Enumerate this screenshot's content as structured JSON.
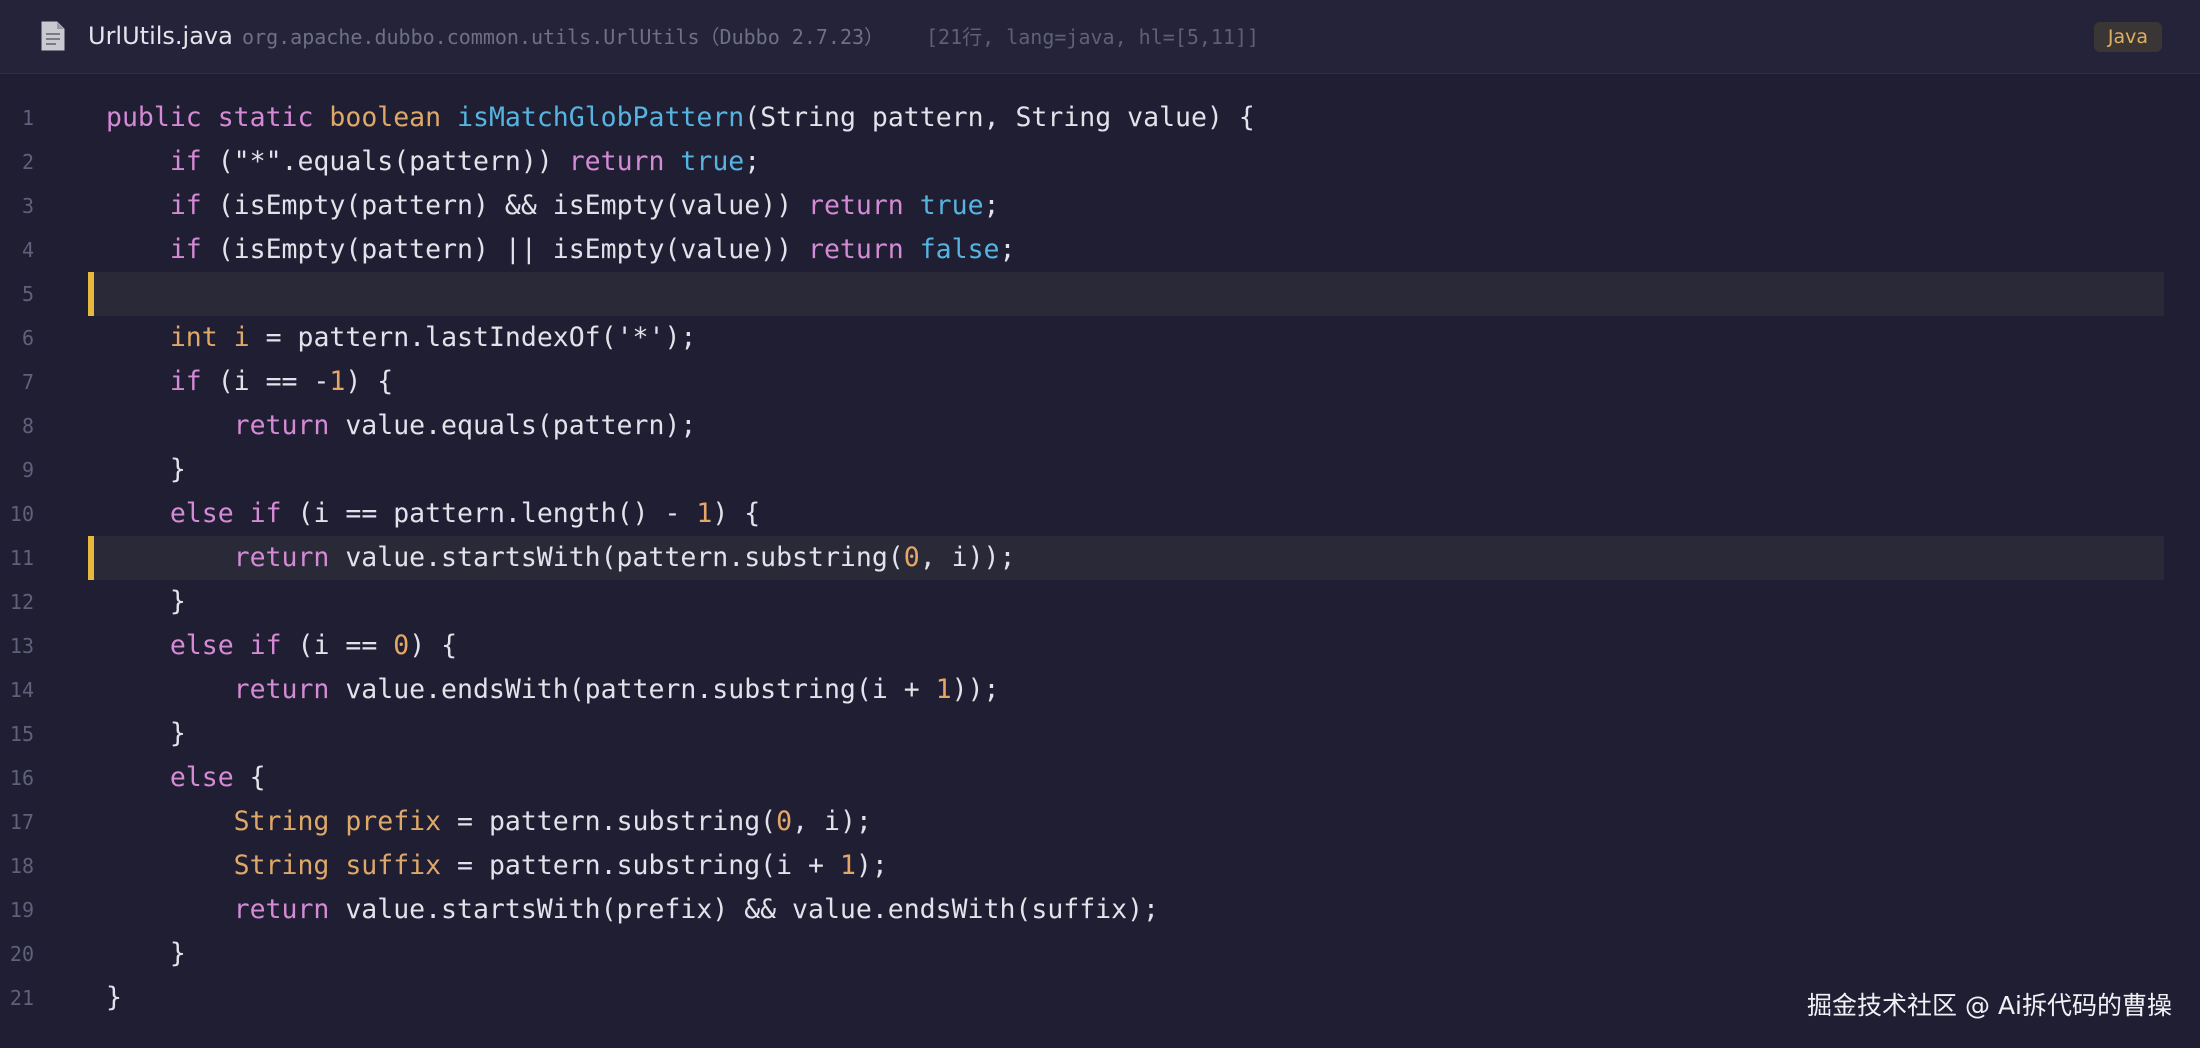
{
  "header": {
    "file_icon": "document-icon",
    "file_name": "UrlUtils.java",
    "file_path": "org.apache.dubbo.common.utils.UrlUtils（Dubbo 2.7.23）",
    "file_meta": "[21行, lang=java, hl=[5,11]]",
    "lang_badge": "Java"
  },
  "code": {
    "highlighted_lines": [
      5,
      11
    ],
    "lines": [
      {
        "n": "1",
        "tokens": [
          {
            "t": "public",
            "c": "kw"
          },
          {
            "t": " ",
            "c": "plain"
          },
          {
            "t": "static",
            "c": "kw"
          },
          {
            "t": " ",
            "c": "plain"
          },
          {
            "t": "boolean",
            "c": "type"
          },
          {
            "t": " ",
            "c": "plain"
          },
          {
            "t": "isMatchGlobPattern",
            "c": "fn"
          },
          {
            "t": "(String pattern, String value) {",
            "c": "plain"
          }
        ]
      },
      {
        "n": "2",
        "tokens": [
          {
            "t": "    ",
            "c": "plain"
          },
          {
            "t": "if",
            "c": "kw"
          },
          {
            "t": " (\"*\".equals(pattern)) ",
            "c": "plain"
          },
          {
            "t": "return",
            "c": "kw"
          },
          {
            "t": " ",
            "c": "plain"
          },
          {
            "t": "true",
            "c": "lit"
          },
          {
            "t": ";",
            "c": "plain"
          }
        ]
      },
      {
        "n": "3",
        "tokens": [
          {
            "t": "    ",
            "c": "plain"
          },
          {
            "t": "if",
            "c": "kw"
          },
          {
            "t": " (isEmpty(pattern) && isEmpty(value)) ",
            "c": "plain"
          },
          {
            "t": "return",
            "c": "kw"
          },
          {
            "t": " ",
            "c": "plain"
          },
          {
            "t": "true",
            "c": "lit"
          },
          {
            "t": ";",
            "c": "plain"
          }
        ]
      },
      {
        "n": "4",
        "tokens": [
          {
            "t": "    ",
            "c": "plain"
          },
          {
            "t": "if",
            "c": "kw"
          },
          {
            "t": " (isEmpty(pattern) || isEmpty(value)) ",
            "c": "plain"
          },
          {
            "t": "return",
            "c": "kw"
          },
          {
            "t": " ",
            "c": "plain"
          },
          {
            "t": "false",
            "c": "lit"
          },
          {
            "t": ";",
            "c": "plain"
          }
        ]
      },
      {
        "n": "5",
        "tokens": []
      },
      {
        "n": "6",
        "tokens": [
          {
            "t": "    ",
            "c": "plain"
          },
          {
            "t": "int",
            "c": "type"
          },
          {
            "t": " ",
            "c": "plain"
          },
          {
            "t": "i",
            "c": "type"
          },
          {
            "t": " = pattern.lastIndexOf('*');",
            "c": "plain"
          }
        ]
      },
      {
        "n": "7",
        "tokens": [
          {
            "t": "    ",
            "c": "plain"
          },
          {
            "t": "if",
            "c": "kw"
          },
          {
            "t": " (i == -",
            "c": "plain"
          },
          {
            "t": "1",
            "c": "num"
          },
          {
            "t": ") {",
            "c": "plain"
          }
        ]
      },
      {
        "n": "8",
        "tokens": [
          {
            "t": "        ",
            "c": "plain"
          },
          {
            "t": "return",
            "c": "kw"
          },
          {
            "t": " value.equals(pattern);",
            "c": "plain"
          }
        ]
      },
      {
        "n": "9",
        "tokens": [
          {
            "t": "    }",
            "c": "plain"
          }
        ]
      },
      {
        "n": "10",
        "tokens": [
          {
            "t": "    ",
            "c": "plain"
          },
          {
            "t": "else",
            "c": "kw"
          },
          {
            "t": " ",
            "c": "plain"
          },
          {
            "t": "if",
            "c": "kw"
          },
          {
            "t": " (i == pattern.length() - ",
            "c": "plain"
          },
          {
            "t": "1",
            "c": "num"
          },
          {
            "t": ") {",
            "c": "plain"
          }
        ]
      },
      {
        "n": "11",
        "tokens": [
          {
            "t": "        ",
            "c": "plain"
          },
          {
            "t": "return",
            "c": "kw"
          },
          {
            "t": " value.startsWith(pattern.substring(",
            "c": "plain"
          },
          {
            "t": "0",
            "c": "num"
          },
          {
            "t": ", i));",
            "c": "plain"
          }
        ]
      },
      {
        "n": "12",
        "tokens": [
          {
            "t": "    }",
            "c": "plain"
          }
        ]
      },
      {
        "n": "13",
        "tokens": [
          {
            "t": "    ",
            "c": "plain"
          },
          {
            "t": "else",
            "c": "kw"
          },
          {
            "t": " ",
            "c": "plain"
          },
          {
            "t": "if",
            "c": "kw"
          },
          {
            "t": " (i == ",
            "c": "plain"
          },
          {
            "t": "0",
            "c": "num"
          },
          {
            "t": ") {",
            "c": "plain"
          }
        ]
      },
      {
        "n": "14",
        "tokens": [
          {
            "t": "        ",
            "c": "plain"
          },
          {
            "t": "return",
            "c": "kw"
          },
          {
            "t": " value.endsWith(pattern.substring(i + ",
            "c": "plain"
          },
          {
            "t": "1",
            "c": "num"
          },
          {
            "t": "));",
            "c": "plain"
          }
        ]
      },
      {
        "n": "15",
        "tokens": [
          {
            "t": "    }",
            "c": "plain"
          }
        ]
      },
      {
        "n": "16",
        "tokens": [
          {
            "t": "    ",
            "c": "plain"
          },
          {
            "t": "else",
            "c": "kw"
          },
          {
            "t": " {",
            "c": "plain"
          }
        ]
      },
      {
        "n": "17",
        "tokens": [
          {
            "t": "        ",
            "c": "plain"
          },
          {
            "t": "String",
            "c": "type"
          },
          {
            "t": " ",
            "c": "plain"
          },
          {
            "t": "prefix",
            "c": "type"
          },
          {
            "t": " = pattern.substring(",
            "c": "plain"
          },
          {
            "t": "0",
            "c": "num"
          },
          {
            "t": ", i);",
            "c": "plain"
          }
        ]
      },
      {
        "n": "18",
        "tokens": [
          {
            "t": "        ",
            "c": "plain"
          },
          {
            "t": "String",
            "c": "type"
          },
          {
            "t": " ",
            "c": "plain"
          },
          {
            "t": "suffix",
            "c": "type"
          },
          {
            "t": " = pattern.substring(i + ",
            "c": "plain"
          },
          {
            "t": "1",
            "c": "num"
          },
          {
            "t": ");",
            "c": "plain"
          }
        ]
      },
      {
        "n": "19",
        "tokens": [
          {
            "t": "        ",
            "c": "plain"
          },
          {
            "t": "return",
            "c": "kw"
          },
          {
            "t": " value.startsWith(prefix) && value.endsWith(suffix);",
            "c": "plain"
          }
        ]
      },
      {
        "n": "20",
        "tokens": [
          {
            "t": "    }",
            "c": "plain"
          }
        ]
      },
      {
        "n": "21",
        "tokens": [
          {
            "t": "}",
            "c": "plain"
          }
        ]
      }
    ]
  },
  "watermark": "掘金技术社区 @ Ai拆代码的曹操",
  "colors": {
    "background": "#1f1e33",
    "keyword": "#d48ad4",
    "type": "#e0a868",
    "function": "#56b4e0",
    "number": "#e6a766",
    "highlight_bar": "#e6b83d"
  }
}
